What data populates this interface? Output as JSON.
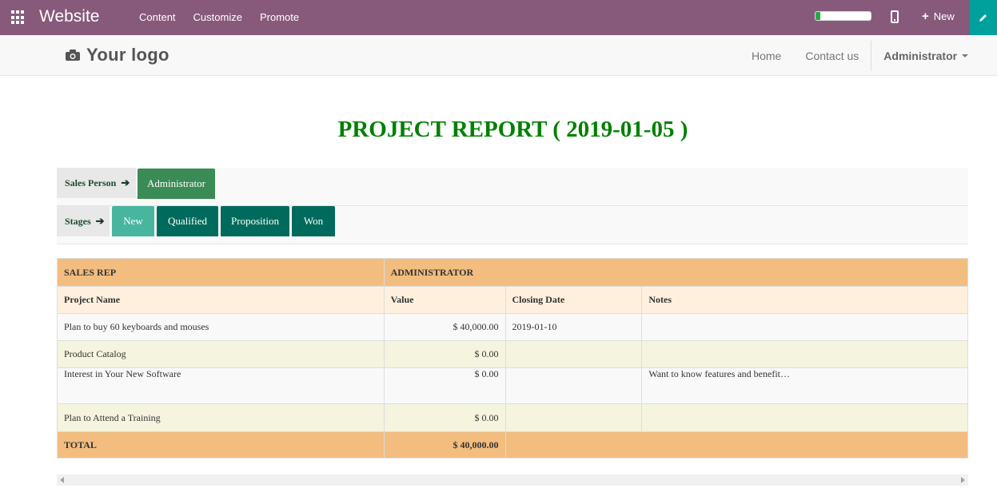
{
  "topbar": {
    "brand": "Website",
    "menu": [
      "Content",
      "Customize",
      "Promote"
    ],
    "progress": 0.08,
    "new_label": "New"
  },
  "site_header": {
    "logo_text": "Your logo",
    "nav": [
      "Home",
      "Contact us"
    ],
    "user": "Administrator"
  },
  "report": {
    "title": "PROJECT REPORT ( 2019-01-05 )",
    "sales_person_label": "Sales Person",
    "sales_person": "Administrator",
    "stages_label": "Stages",
    "stages": [
      "New",
      "Qualified",
      "Proposition",
      "Won"
    ],
    "group_header": {
      "label": "SALES REP",
      "value": "ADMINISTRATOR"
    },
    "columns": [
      "Project Name",
      "Value",
      "Closing Date",
      "Notes"
    ],
    "rows": [
      {
        "name": "Plan to buy 60 keyboards and mouses",
        "value": "$ 40,000.00",
        "date": "2019-01-10",
        "notes": ""
      },
      {
        "name": "Product Catalog",
        "value": "$ 0.00",
        "date": "",
        "notes": ""
      },
      {
        "name": "Interest in Your New Software",
        "value": "$ 0.00",
        "date": "",
        "notes": "Want to know features and benefit…"
      },
      {
        "name": "Plan to Attend a Training",
        "value": "$ 0.00",
        "date": "",
        "notes": ""
      }
    ],
    "total_label": "TOTAL",
    "total_value": "$ 40,000.00"
  },
  "colors": {
    "topbar": "#875a7b",
    "edit_button": "#00a09d",
    "title_green": "#008000",
    "stage_active": "#48b59f",
    "stage": "#006b5c",
    "sales_person_chip": "#3a8b55",
    "header_orange": "#f2bd7f"
  }
}
